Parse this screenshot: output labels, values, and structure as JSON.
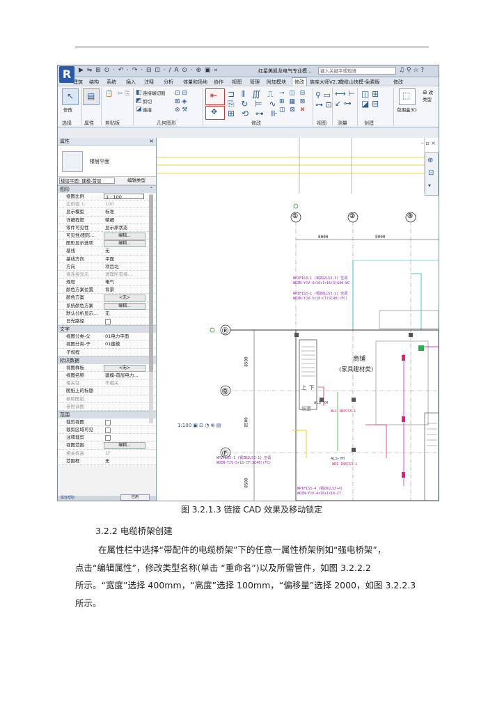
{
  "screenshot": {
    "title": "红星美凯龙电气专业模…",
    "search_placeholder": "键入关键字或短语",
    "quick_access": "▶ ⇋ ⊞ ⊙ · ↶ · ↷ · ⊟ ⊡ · ∕ A ⊙ · ⊕ ▣ »",
    "ribbon_tabs": [
      "建筑",
      "结构",
      "系统",
      "插入",
      "注释",
      "分析",
      "体量和场地",
      "协作",
      "视图",
      "管理",
      "附加模块",
      "修改",
      "族库大师V2.2",
      "橄榄山快模-免费版",
      "修改"
    ],
    "ribbon": {
      "modify": "修改",
      "connect_cut": "连接端切割",
      "cut": "剪切",
      "join": "连接",
      "panels": [
        "选择",
        "属性",
        "剪贴板",
        "几何图形",
        "修改",
        "视图",
        "测量",
        "创建"
      ],
      "parts": "创建零件",
      "other": "单 改 类型",
      "create_3d": "包围盒3D"
    },
    "properties": {
      "title": "属性",
      "close": "×",
      "type_name": "楼层平面",
      "instance_selector": "楼层平面: 建模-首层",
      "edit_type": "编辑类型",
      "groups": [
        {
          "name": "图形",
          "rows": [
            {
              "k": "视图比例",
              "v": "1 : 100",
              "kind": "input"
            },
            {
              "k": "比例值 1:",
              "v": "100",
              "kind": "dim"
            },
            {
              "k": "显示模型",
              "v": "标准"
            },
            {
              "k": "详细程度",
              "v": "精细"
            },
            {
              "k": "零件可见性",
              "v": "显示原状态"
            },
            {
              "k": "可见性/图形...",
              "v": "编辑...",
              "kind": "btn"
            },
            {
              "k": "图形显示选项",
              "v": "编辑...",
              "kind": "btn"
            },
            {
              "k": "基线",
              "v": "无"
            },
            {
              "k": "基线方向",
              "v": "平面"
            },
            {
              "k": "方向",
              "v": "项目北"
            },
            {
              "k": "墙连接显示",
              "v": "清理所有墙...",
              "kind": "dim"
            },
            {
              "k": "规程",
              "v": "电气"
            },
            {
              "k": "颜色方案位置",
              "v": "背景"
            },
            {
              "k": "颜色方案",
              "v": "<无>",
              "kind": "btn"
            },
            {
              "k": "系统颜色方案",
              "v": "编辑...",
              "kind": "btn"
            },
            {
              "k": "默认分析显示...",
              "v": "无"
            },
            {
              "k": "日光路径",
              "v": "",
              "kind": "chk"
            }
          ]
        },
        {
          "name": "文字",
          "rows": [
            {
              "k": "视图分类-父",
              "v": "01电力平面"
            },
            {
              "k": "视图分类-子",
              "v": "01建模"
            },
            {
              "k": "子规程",
              "v": ""
            }
          ]
        },
        {
          "name": "标识数据",
          "rows": [
            {
              "k": "视图样板",
              "v": "<无>",
              "kind": "btn"
            },
            {
              "k": "视图名称",
              "v": "建模-首层电力..."
            },
            {
              "k": "相关性",
              "v": "不相关",
              "kind": "dim"
            },
            {
              "k": "图纸上的标题",
              "v": ""
            },
            {
              "k": "参照图纸",
              "v": "",
              "kind": "dim"
            },
            {
              "k": "参照详图",
              "v": "",
              "kind": "dim"
            }
          ]
        },
        {
          "name": "范围",
          "rows": [
            {
              "k": "裁剪视图",
              "v": "",
              "kind": "chk"
            },
            {
              "k": "裁剪区域可见",
              "v": "",
              "kind": "chk"
            },
            {
              "k": "注释裁剪",
              "v": "",
              "kind": "chk"
            },
            {
              "k": "视图范围",
              "v": "编辑...",
              "kind": "btn"
            },
            {
              "k": "相关标高",
              "v": "1F",
              "kind": "dim"
            },
            {
              "k": "范围框",
              "v": "无"
            }
          ]
        }
      ],
      "help_link": "属性帮助",
      "apply": "应用"
    },
    "drawing": {
      "grid_labels": [
        "①",
        "②",
        "③",
        "Ⓡ",
        "Ⓠ",
        "Ⓟ"
      ],
      "dims": [
        "8000",
        "8000",
        "8500",
        "8500",
        "8500"
      ],
      "shop_name": "商铺",
      "shop_sub": "(家具建材类)",
      "room2": "前室",
      "stair": "上  下",
      "marks": [
        "WP2F1S3-1 (铜ZR2LS3-1) 空调",
        "WDZN-YJV-4×16+1×16(S)G40-WC",
        "WP1F1S3-1 (铜ZR1LS3-1) 空调",
        "WDZN-YJV-5×10-CT(SC40)(FC)",
        "ALS-YH",
        "WL1 1N3CS3-1",
        "ALS-YH",
        "WD1 1N3CS3-1",
        "WP2F1S3-1 (铜ZR2LS3-1) 空调",
        "WDZN-YJV-5×16-CT(SC40)(FC)",
        "WP1F1S3-4 (铜ZR1LS3-4)",
        "WDZN-YJV-4×16+1×16-CT"
      ],
      "status": "1:100  ▣ ⊡ ◔ ⊕ ▤"
    }
  },
  "document": {
    "caption": "图 3.2.1.3 链接 CAD 效果及移动锁定",
    "section_heading": "3.2.2 电缆桥架创建",
    "paragraph_lines": [
      "在属性栏中选择“带配件的电缆桥架”下的任意一属性桥架例如“强电桥架”，",
      "点击“编辑属性”，修改类型名称(单击 “重命名”)以及所需管件，如图 3.2.2.2",
      "所示。“宽度”选择 400mm，“高度”选择 100mm，“偏移量”选择 2000，如图 3.2.2.3",
      "所示。"
    ]
  }
}
